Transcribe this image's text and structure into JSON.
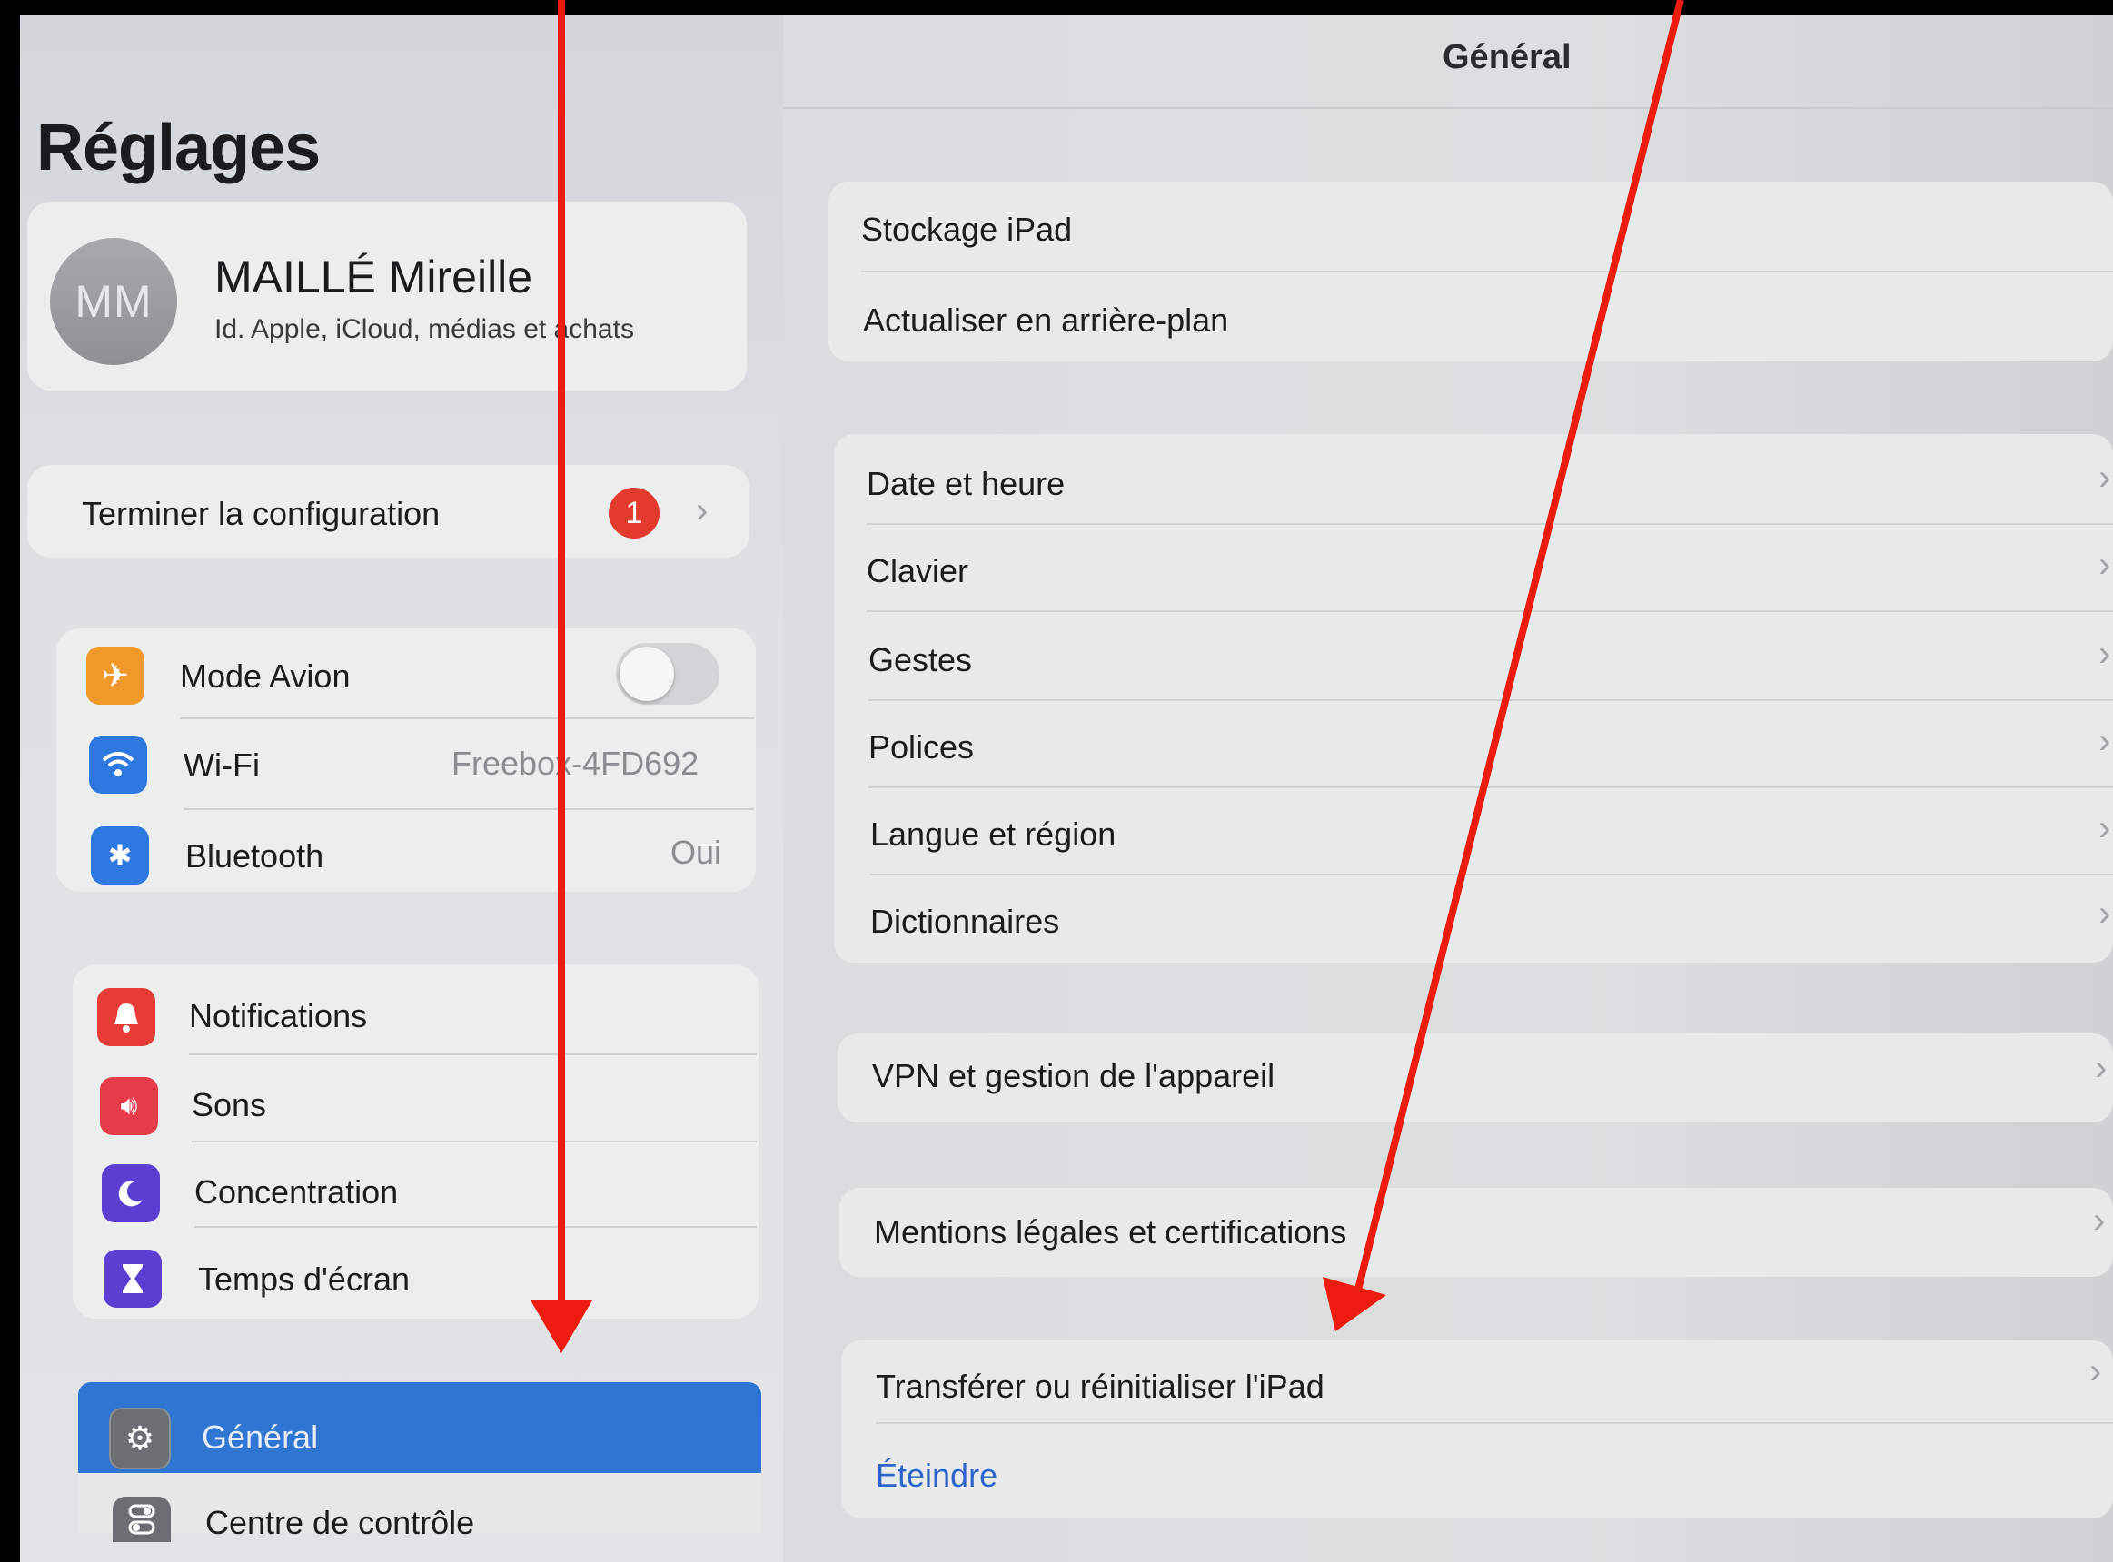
{
  "sidebar": {
    "title": "Réglages",
    "profile": {
      "initials": "MM",
      "name": "MAILLÉ Mireille",
      "subtitle": "Id. Apple, iCloud, médias et achats"
    },
    "setup": {
      "label": "Terminer la configuration",
      "badge": "1"
    },
    "connectivity": [
      {
        "label": "Mode Avion",
        "icon": "airplane-icon",
        "color": "#f0982a",
        "value": ""
      },
      {
        "label": "Wi-Fi",
        "icon": "wifi-icon",
        "color": "#2f78e0",
        "value": "Freebox-4FD692"
      },
      {
        "label": "Bluetooth",
        "icon": "bluetooth-icon",
        "color": "#2f78e0",
        "value": "Oui"
      }
    ],
    "attention": [
      {
        "label": "Notifications",
        "icon": "bell-icon",
        "color": "#e63b36"
      },
      {
        "label": "Sons",
        "icon": "speaker-icon",
        "color": "#e63b48"
      },
      {
        "label": "Concentration",
        "icon": "moon-icon",
        "color": "#5a3fd0"
      },
      {
        "label": "Temps d'écran",
        "icon": "hourglass-icon",
        "color": "#5a3fd0"
      }
    ],
    "system": [
      {
        "label": "Général",
        "icon": "gear-icon",
        "selected": true
      },
      {
        "label": "Centre de contrôle",
        "icon": "switches-icon",
        "selected": false
      }
    ]
  },
  "detail": {
    "title": "Général",
    "items": {
      "stockage": "Stockage iPad",
      "actualiser": "Actualiser en arrière-plan",
      "date": "Date et heure",
      "clavier": "Clavier",
      "gestes": "Gestes",
      "polices": "Polices",
      "langue": "Langue et région",
      "dictionnaires": "Dictionnaires",
      "vpn": "VPN et gestion de l'appareil",
      "mentions": "Mentions légales et certifications",
      "transferer": "Transférer ou réinitialiser l'iPad",
      "eteindre": "Éteindre"
    }
  },
  "colors": {
    "selection": "#2f76d2",
    "badge": "#e23a2c",
    "annotation": "#ee1c10",
    "link": "#2f64c8"
  }
}
